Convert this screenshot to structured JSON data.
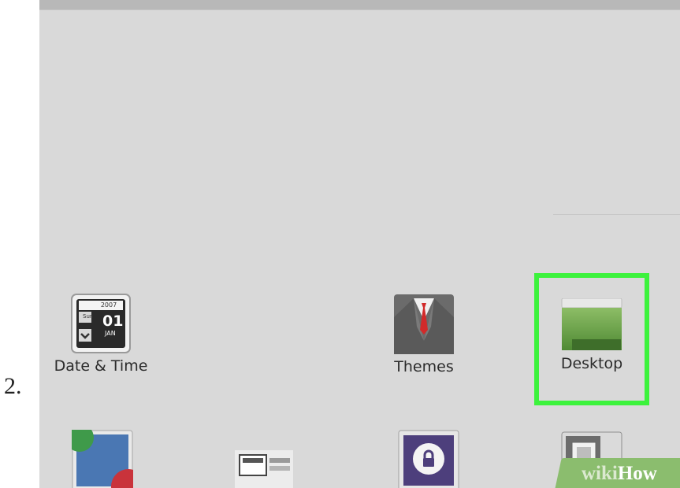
{
  "step": {
    "number": "2."
  },
  "apps": [
    {
      "label": "Date & Time",
      "icon": "date-time-icon",
      "calendar_year": "2007",
      "calendar_weekday": "Sun",
      "calendar_day": "01",
      "calendar_month": "JAN"
    },
    {
      "label": "Themes",
      "icon": "themes-icon"
    },
    {
      "label": "Desktop",
      "icon": "desktop-icon",
      "highlighted": true
    }
  ],
  "partial_row_icons": [
    "color-icon",
    "window-tiles-icon",
    "lock-screen-icon",
    "windows-icon"
  ],
  "colors": {
    "panel_background": "#d9d9d9",
    "highlight_border": "#3cf23c",
    "watermark_green": "#8bbd6e"
  },
  "watermark": {
    "part1": "wiki",
    "part2": "How"
  }
}
